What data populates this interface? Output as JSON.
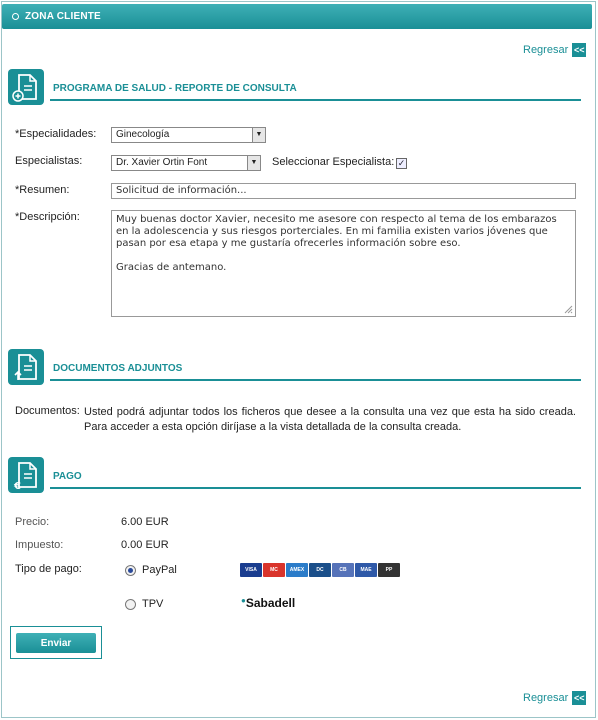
{
  "header": {
    "title": "ZONA CLIENTE"
  },
  "back": {
    "label": "Regresar",
    "icon_text": "<<"
  },
  "consulta": {
    "section_title": "PROGRAMA DE SALUD - REPORTE DE CONSULTA",
    "especialidades_label": "*Especialidades:",
    "especialidades_value": "Ginecología",
    "especialistas_label": "Especialistas:",
    "especialistas_value": "Dr. Xavier Ortin Font",
    "seleccionar_label": "Seleccionar Especialista:",
    "seleccionar_checked": true,
    "resumen_label": "*Resumen:",
    "resumen_value": "Solicitud de información...",
    "descripcion_label": "*Descripción:",
    "descripcion_value": "Muy buenas doctor Xavier, necesito me asesore con respecto al tema de los embarazos en la adolescencia y sus riesgos porterciales. En mi familia existen varios jóvenes que pasan por esa etapa y me gustaría ofrecerles información sobre eso.\n\nGracias de antemano."
  },
  "documentos": {
    "section_title": "DOCUMENTOS ADJUNTOS",
    "label": "Documentos:",
    "text": "Usted podrá adjuntar todos los ficheros que desee a la consulta una vez que esta ha sido creada. Para acceder a esta opción diríjase a la vista detallada de la consulta creada."
  },
  "pago": {
    "section_title": "PAGO",
    "precio_label": "Precio:",
    "precio_value": "6.00 EUR",
    "impuesto_label": "Impuesto:",
    "impuesto_value": "0.00 EUR",
    "tipo_label": "Tipo de pago:",
    "option_paypal": "PayPal",
    "option_tpv": "TPV",
    "selected": "PayPal",
    "bank_logo": "Sabadell",
    "cards": [
      {
        "name": "VISA",
        "color": "#1a3d8f"
      },
      {
        "name": "MC",
        "color": "#d9342b"
      },
      {
        "name": "AMEX",
        "color": "#2b7cc9"
      },
      {
        "name": "DC",
        "color": "#1b4f8a"
      },
      {
        "name": "CB",
        "color": "#5673b9"
      },
      {
        "name": "MAE",
        "color": "#2f59a8"
      },
      {
        "name": "PP",
        "color": "#333333"
      }
    ]
  },
  "submit": {
    "label": "Enviar"
  }
}
